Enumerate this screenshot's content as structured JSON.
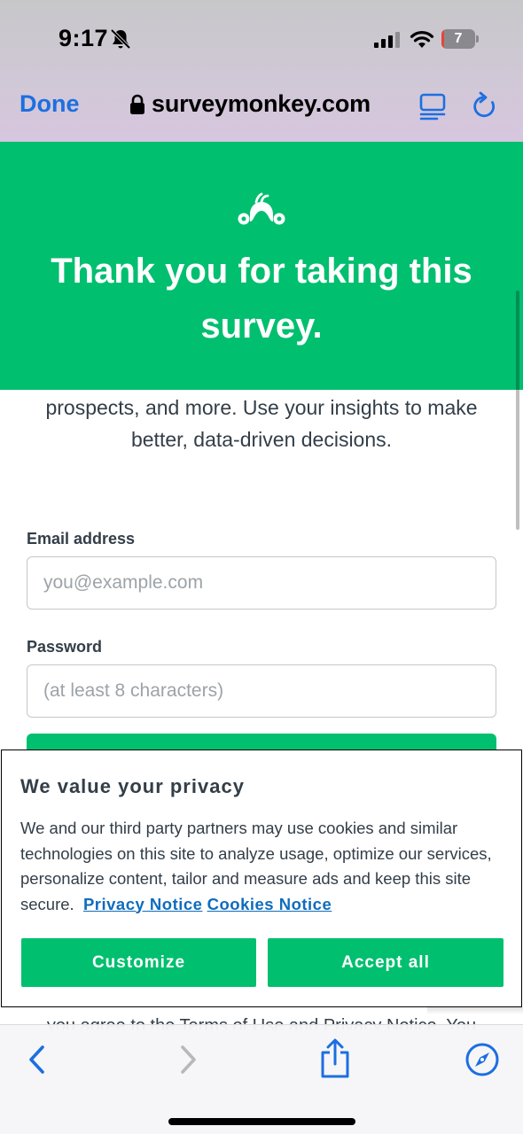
{
  "status_bar": {
    "time": "9:17",
    "battery_percent": "7",
    "battery_level": 0.07,
    "icons": [
      "bell-slash-icon",
      "cellular-signal-icon",
      "wifi-icon",
      "battery-icon"
    ]
  },
  "browser": {
    "done_label": "Done",
    "url": "surveymonkey.com",
    "icons": [
      "lock-icon",
      "reader-icon",
      "reload-icon"
    ],
    "toolbar_icons": [
      "back-icon",
      "forward-icon",
      "share-icon",
      "compass-icon"
    ]
  },
  "hero": {
    "logo": "surveymonkey-logo-icon",
    "title": "Thank you for taking this survey."
  },
  "pitch": {
    "text": "prospects, and more. Use your insights to make better, data-driven decisions."
  },
  "signup_form": {
    "email_label": "Email address",
    "email_placeholder": "you@example.com",
    "email_value": "",
    "password_label": "Password",
    "password_placeholder": "(at least 8 characters)",
    "password_value": ""
  },
  "privacy": {
    "title": "We value your privacy",
    "body": "We and our third party partners may use cookies and similar technologies on this site to analyze usage, optimize our services, personalize content, tailor and measure ads and keep this site secure.",
    "privacy_link": "Privacy Notice",
    "cookies_link": "Cookies Notice",
    "customize_label": "Customize",
    "accept_label": "Accept all"
  },
  "terms_peek": {
    "text": "you agree to the Terms of Use and Privacy Notice. You"
  },
  "colors": {
    "brand_green": "#00bf6f",
    "link_blue": "#0f6cbd",
    "ios_blue": "#1c6fe0"
  }
}
